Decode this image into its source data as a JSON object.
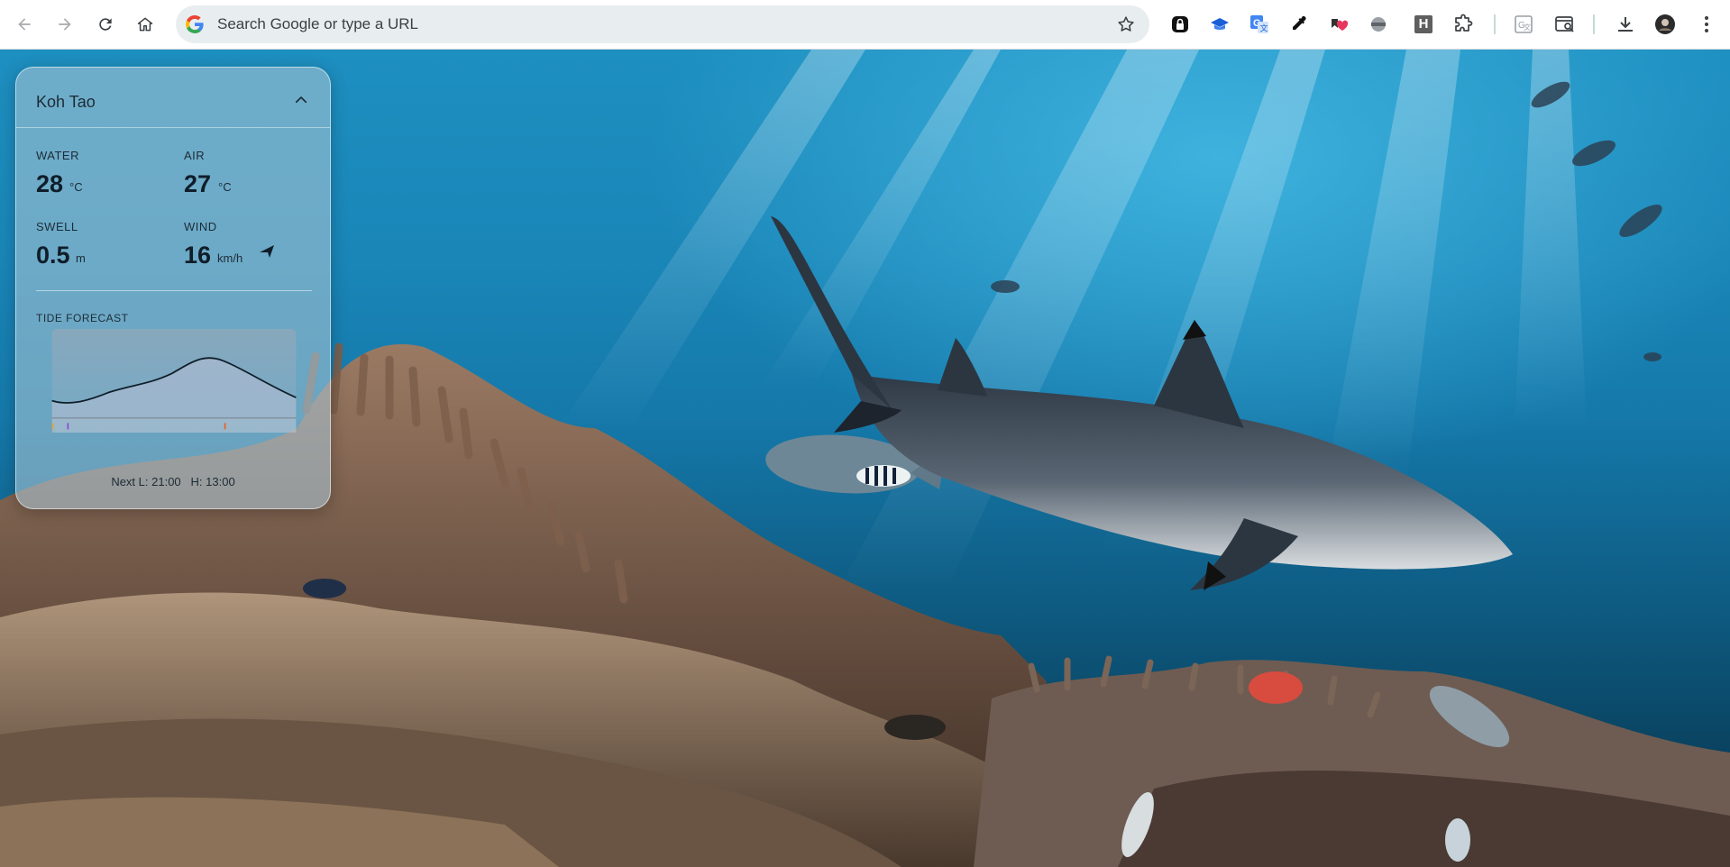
{
  "browser": {
    "nav": {
      "back_icon": "arrow-left-icon",
      "forward_icon": "arrow-right-icon",
      "reload_icon": "reload-icon",
      "home_icon": "home-icon"
    },
    "omnibox": {
      "placeholder": "Search Google or type a URL",
      "value": "",
      "bookmark_icon": "star-icon"
    },
    "extensions": [
      {
        "icon": "padlock-extension-icon"
      },
      {
        "icon": "graduation-cap-extension-icon"
      },
      {
        "icon": "translate-extension-icon"
      },
      {
        "icon": "eyedropper-extension-icon"
      },
      {
        "icon": "heart-extension-icon"
      },
      {
        "icon": "grey-circle-extension-icon"
      },
      {
        "icon": "h-extension-icon"
      },
      {
        "icon": "puzzle-piece-icon"
      },
      {
        "icon": "google-translate-icon"
      },
      {
        "icon": "tab-search-icon"
      },
      {
        "icon": "download-icon"
      },
      {
        "icon": "profile-avatar"
      },
      {
        "icon": "kebab-menu-icon"
      }
    ],
    "h_extension_letter": "H",
    "colors": {
      "toolbar": "#ffffff",
      "omnibox": "#e8eef0"
    }
  },
  "widget": {
    "location": "Koh Tao",
    "collapse_icon": "chevron-up-icon",
    "water": {
      "label": "WATER",
      "value": "28",
      "unit": "°C"
    },
    "air": {
      "label": "AIR",
      "value": "27",
      "unit": "°C"
    },
    "swell": {
      "label": "SWELL",
      "value": "0.5",
      "unit": "m"
    },
    "wind": {
      "label": "WIND",
      "value": "16",
      "unit": "km/h",
      "direction_icon": "wind-direction-arrow-icon"
    },
    "tide": {
      "label": "TIDE FORECAST",
      "next_low_label": "Next L:",
      "next_low": "21:00",
      "next_high_label": "H:",
      "next_high": "13:00"
    }
  }
}
